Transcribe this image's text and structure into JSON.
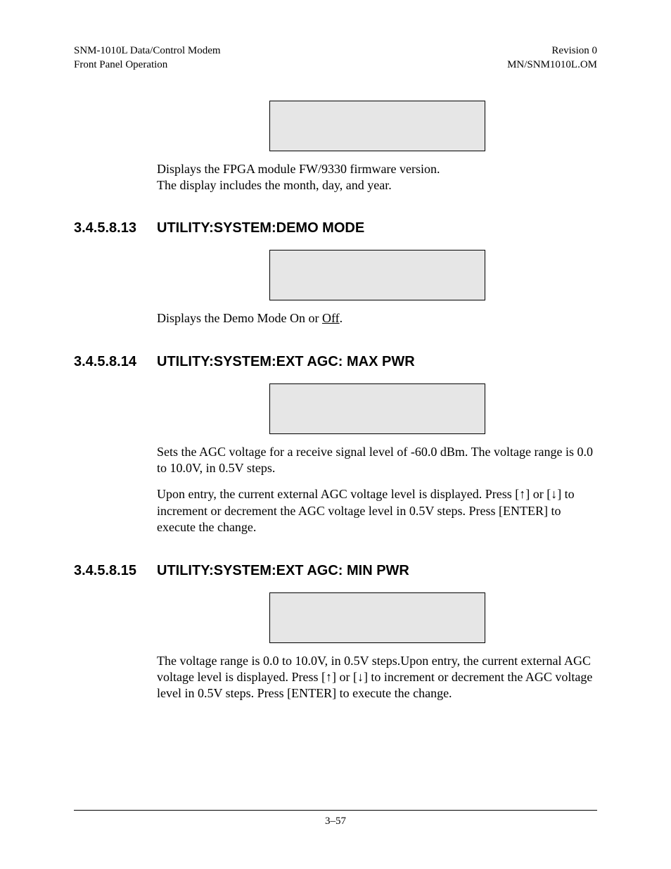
{
  "header": {
    "left_line1": "SNM-1010L Data/Control Modem",
    "left_line2": "Front Panel Operation",
    "right_line1": "Revision 0",
    "right_line2": "MN/SNM1010L.OM"
  },
  "section0": {
    "para1": "Displays the FPGA module FW/9330 firmware version.",
    "para2": "The display includes the month, day, and year."
  },
  "section13": {
    "number": "3.4.5.8.13",
    "title": "UTILITY:SYSTEM:DEMO MODE",
    "para_pre": "Displays the Demo Mode On or ",
    "para_underlined": "Off",
    "para_post": "."
  },
  "section14": {
    "number": "3.4.5.8.14",
    "title": "UTILITY:SYSTEM:EXT AGC: MAX PWR",
    "para1": "Sets the AGC voltage for a receive signal level of -60.0 dBm. The voltage range is 0.0 to 10.0V, in 0.5V steps.",
    "para2_a": "Upon entry, the current external AGC voltage level is displayed. Press [",
    "para2_b": "] or [",
    "para2_c": "] to increment or decrement the AGC voltage level in 0.5V steps. Press [ENTER] to execute the change."
  },
  "section15": {
    "number": "3.4.5.8.15",
    "title": "UTILITY:SYSTEM:EXT AGC: MIN PWR",
    "para_a": "The voltage range is 0.0 to 10.0V, in 0.5V steps.Upon entry, the current external AGC voltage level is displayed. Press [",
    "para_b": "] or [",
    "para_c": "] to increment or decrement the AGC voltage level in 0.5V steps. Press [ENTER] to execute the change."
  },
  "symbols": {
    "up": "↑",
    "down": "↓"
  },
  "footer": {
    "page": "3–57"
  }
}
